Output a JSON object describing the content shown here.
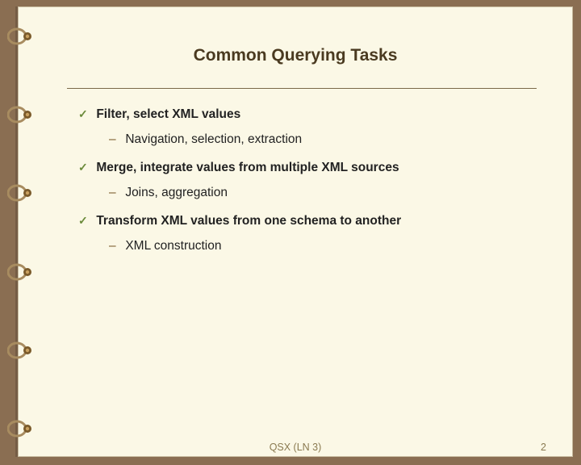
{
  "title": "Common Querying Tasks",
  "bullets": {
    "b1": {
      "text": "Filter, select XML values",
      "sub": "Navigation, selection, extraction"
    },
    "b2": {
      "text": "Merge, integrate values from multiple XML sources",
      "sub": "Joins, aggregation"
    },
    "b3": {
      "text": "Transform XML values from one schema to another",
      "sub": "XML construction"
    }
  },
  "glyphs": {
    "check": "✓",
    "dash": "–"
  },
  "footer": {
    "center": "QSX (LN 3)",
    "page": "2"
  }
}
